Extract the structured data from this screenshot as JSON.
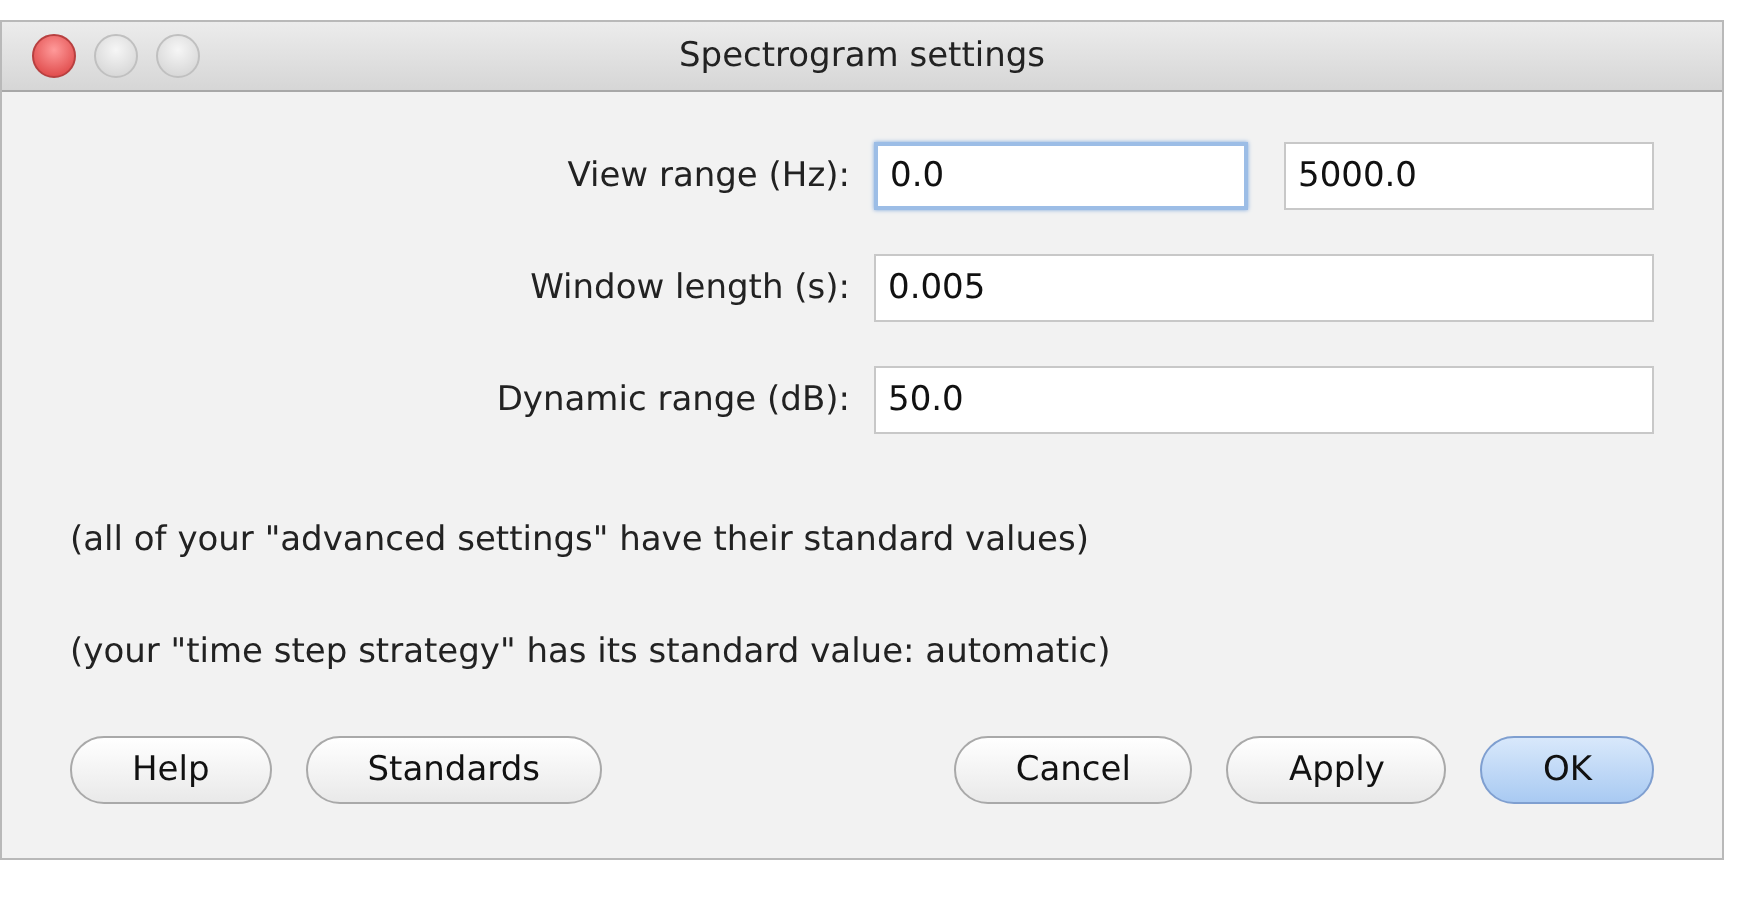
{
  "window": {
    "title": "Spectrogram settings"
  },
  "fields": [
    {
      "label": "View range (Hz):",
      "inputs": [
        {
          "value": "0.0",
          "focused": true
        },
        {
          "value": "5000.0",
          "focused": false
        }
      ]
    },
    {
      "label": "Window length (s):",
      "inputs": [
        {
          "value": "0.005",
          "focused": false
        }
      ]
    },
    {
      "label": "Dynamic range (dB):",
      "inputs": [
        {
          "value": "50.0",
          "focused": false
        }
      ]
    }
  ],
  "notes": [
    "(all of your \"advanced settings\" have their standard values)",
    "(your \"time step strategy\" has its standard value: automatic)"
  ],
  "buttons_left": [
    {
      "label": "Help",
      "default": false
    },
    {
      "label": "Standards",
      "default": false
    }
  ],
  "buttons_right": [
    {
      "label": "Cancel",
      "default": false
    },
    {
      "label": "Apply",
      "default": false
    },
    {
      "label": "OK",
      "default": true
    }
  ]
}
